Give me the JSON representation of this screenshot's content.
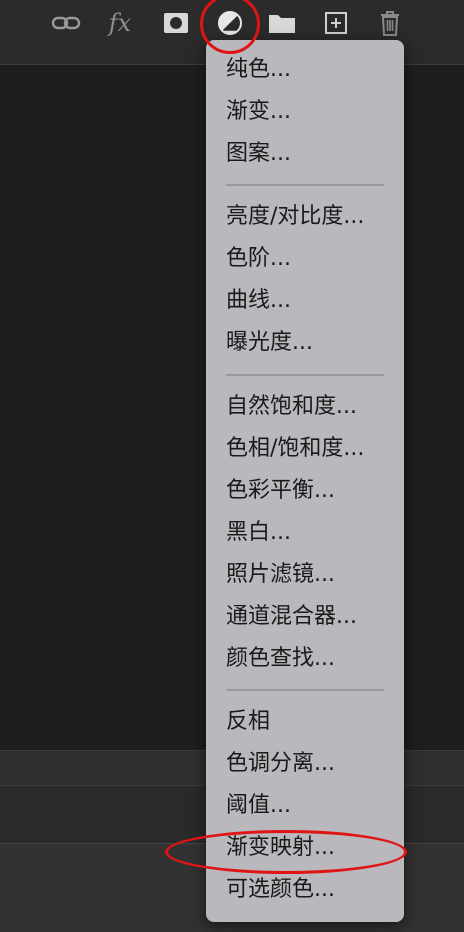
{
  "toolbar": {
    "buttons": [
      {
        "name": "link-icon"
      },
      {
        "name": "fx-icon",
        "label": "fx"
      },
      {
        "name": "mask-icon"
      },
      {
        "name": "adjustment-layer-icon"
      },
      {
        "name": "folder-icon"
      },
      {
        "name": "new-layer-icon"
      },
      {
        "name": "trash-icon"
      }
    ]
  },
  "menu": {
    "items": [
      "纯色...",
      "渐变...",
      "图案...",
      "亮度/对比度...",
      "色阶...",
      "曲线...",
      "曝光度...",
      "自然饱和度...",
      "色相/饱和度...",
      "色彩平衡...",
      "黑白...",
      "照片滤镜...",
      "通道混合器...",
      "颜色查找...",
      "反相",
      "色调分离...",
      "阈值...",
      "渐变映射...",
      "可选颜色..."
    ]
  },
  "colors": {
    "menu_bg": "#b9b8bd",
    "annotation": "#e01414",
    "panel_bg": "#1e1e1e"
  }
}
